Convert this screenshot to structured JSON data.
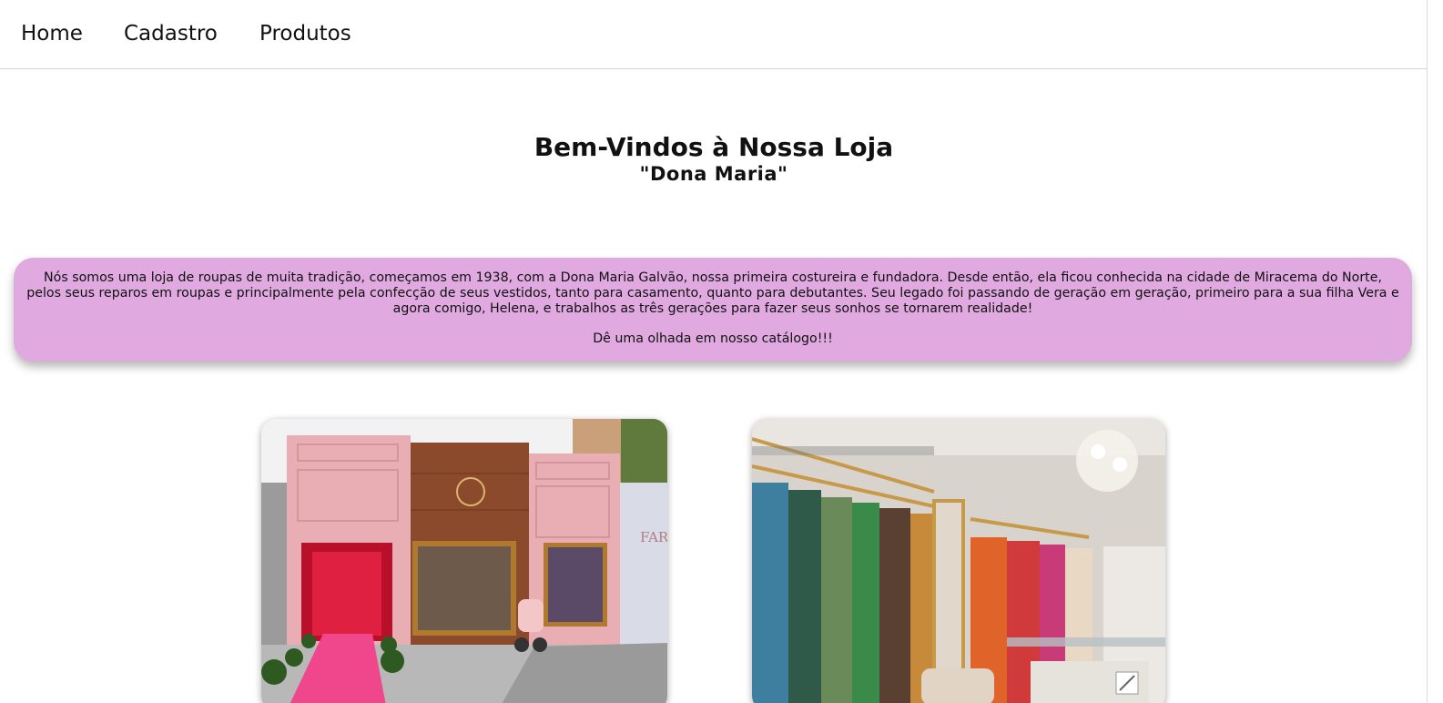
{
  "nav": {
    "home": "Home",
    "cadastro": "Cadastro",
    "produtos": "Produtos"
  },
  "hero": {
    "title": "Bem-Vindos à Nossa Loja",
    "subtitle": "\"Dona Maria\""
  },
  "about": {
    "text": "Nós somos uma loja de roupas de muita tradição, começamos em 1938, com a Dona Maria Galvão, nossa primeira costureira e fundadora. Desde então, ela ficou conhecida na cidade de Miracema do Norte, pelos seus reparos em roupas e principalmente pela confecção de seus vestidos, tanto para casamento, quanto para debutantes. Seu legado foi passando de geração em geração, primeiro para a sua filha Vera e agora comigo, Helena, e trabalhos as três gerações para fazer seus sonhos se tornarem realidade!",
    "cta": "Dê uma olhada em nosso catálogo!!!"
  },
  "colors": {
    "about_background": "#e0a9e0",
    "storefront_pink": "#e8aeb4",
    "carpet_pink": "#f0468c"
  },
  "storefront_photo": {
    "sign_text": "FARO"
  }
}
